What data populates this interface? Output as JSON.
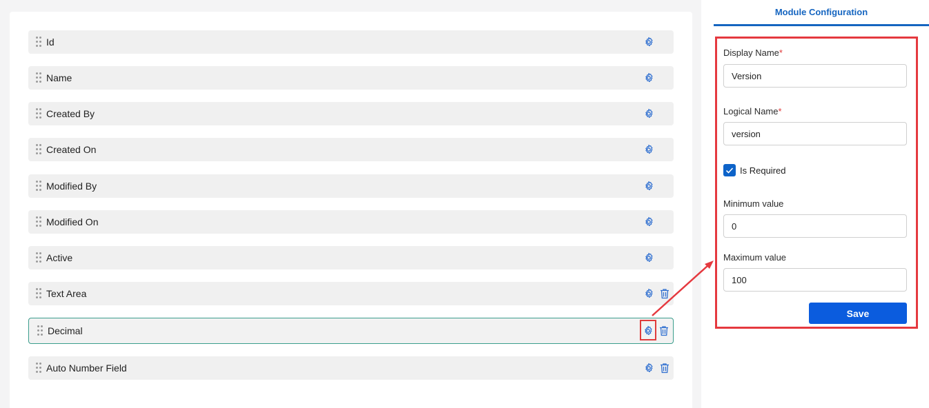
{
  "fields": [
    {
      "label": "Id",
      "deletable": false
    },
    {
      "label": "Name",
      "deletable": false
    },
    {
      "label": "Created By",
      "deletable": false
    },
    {
      "label": "Created On",
      "deletable": false
    },
    {
      "label": "Modified By",
      "deletable": false
    },
    {
      "label": "Modified On",
      "deletable": false
    },
    {
      "label": "Active",
      "deletable": false
    },
    {
      "label": "Text Area",
      "deletable": true
    },
    {
      "label": "Decimal",
      "deletable": true,
      "selected": true
    },
    {
      "label": "Auto Number Field",
      "deletable": true
    }
  ],
  "panel": {
    "title": "Module Configuration",
    "display_name_label": "Display Name",
    "display_name_value": "Version",
    "logical_name_label": "Logical Name",
    "logical_name_value": "version",
    "required_marker": "*",
    "is_required_label": "Is Required",
    "is_required_checked": true,
    "min_label": "Minimum value",
    "min_value": "0",
    "max_label": "Maximum value",
    "max_value": "100",
    "save_label": "Save"
  },
  "colors": {
    "accent": "#1565c0",
    "highlight": "#e5393f",
    "selected_border": "#3a9d8c",
    "icon": "#2f6fd0"
  },
  "icons": [
    "drag-handle-icon",
    "gear-icon",
    "trash-icon",
    "checkmark-icon"
  ]
}
